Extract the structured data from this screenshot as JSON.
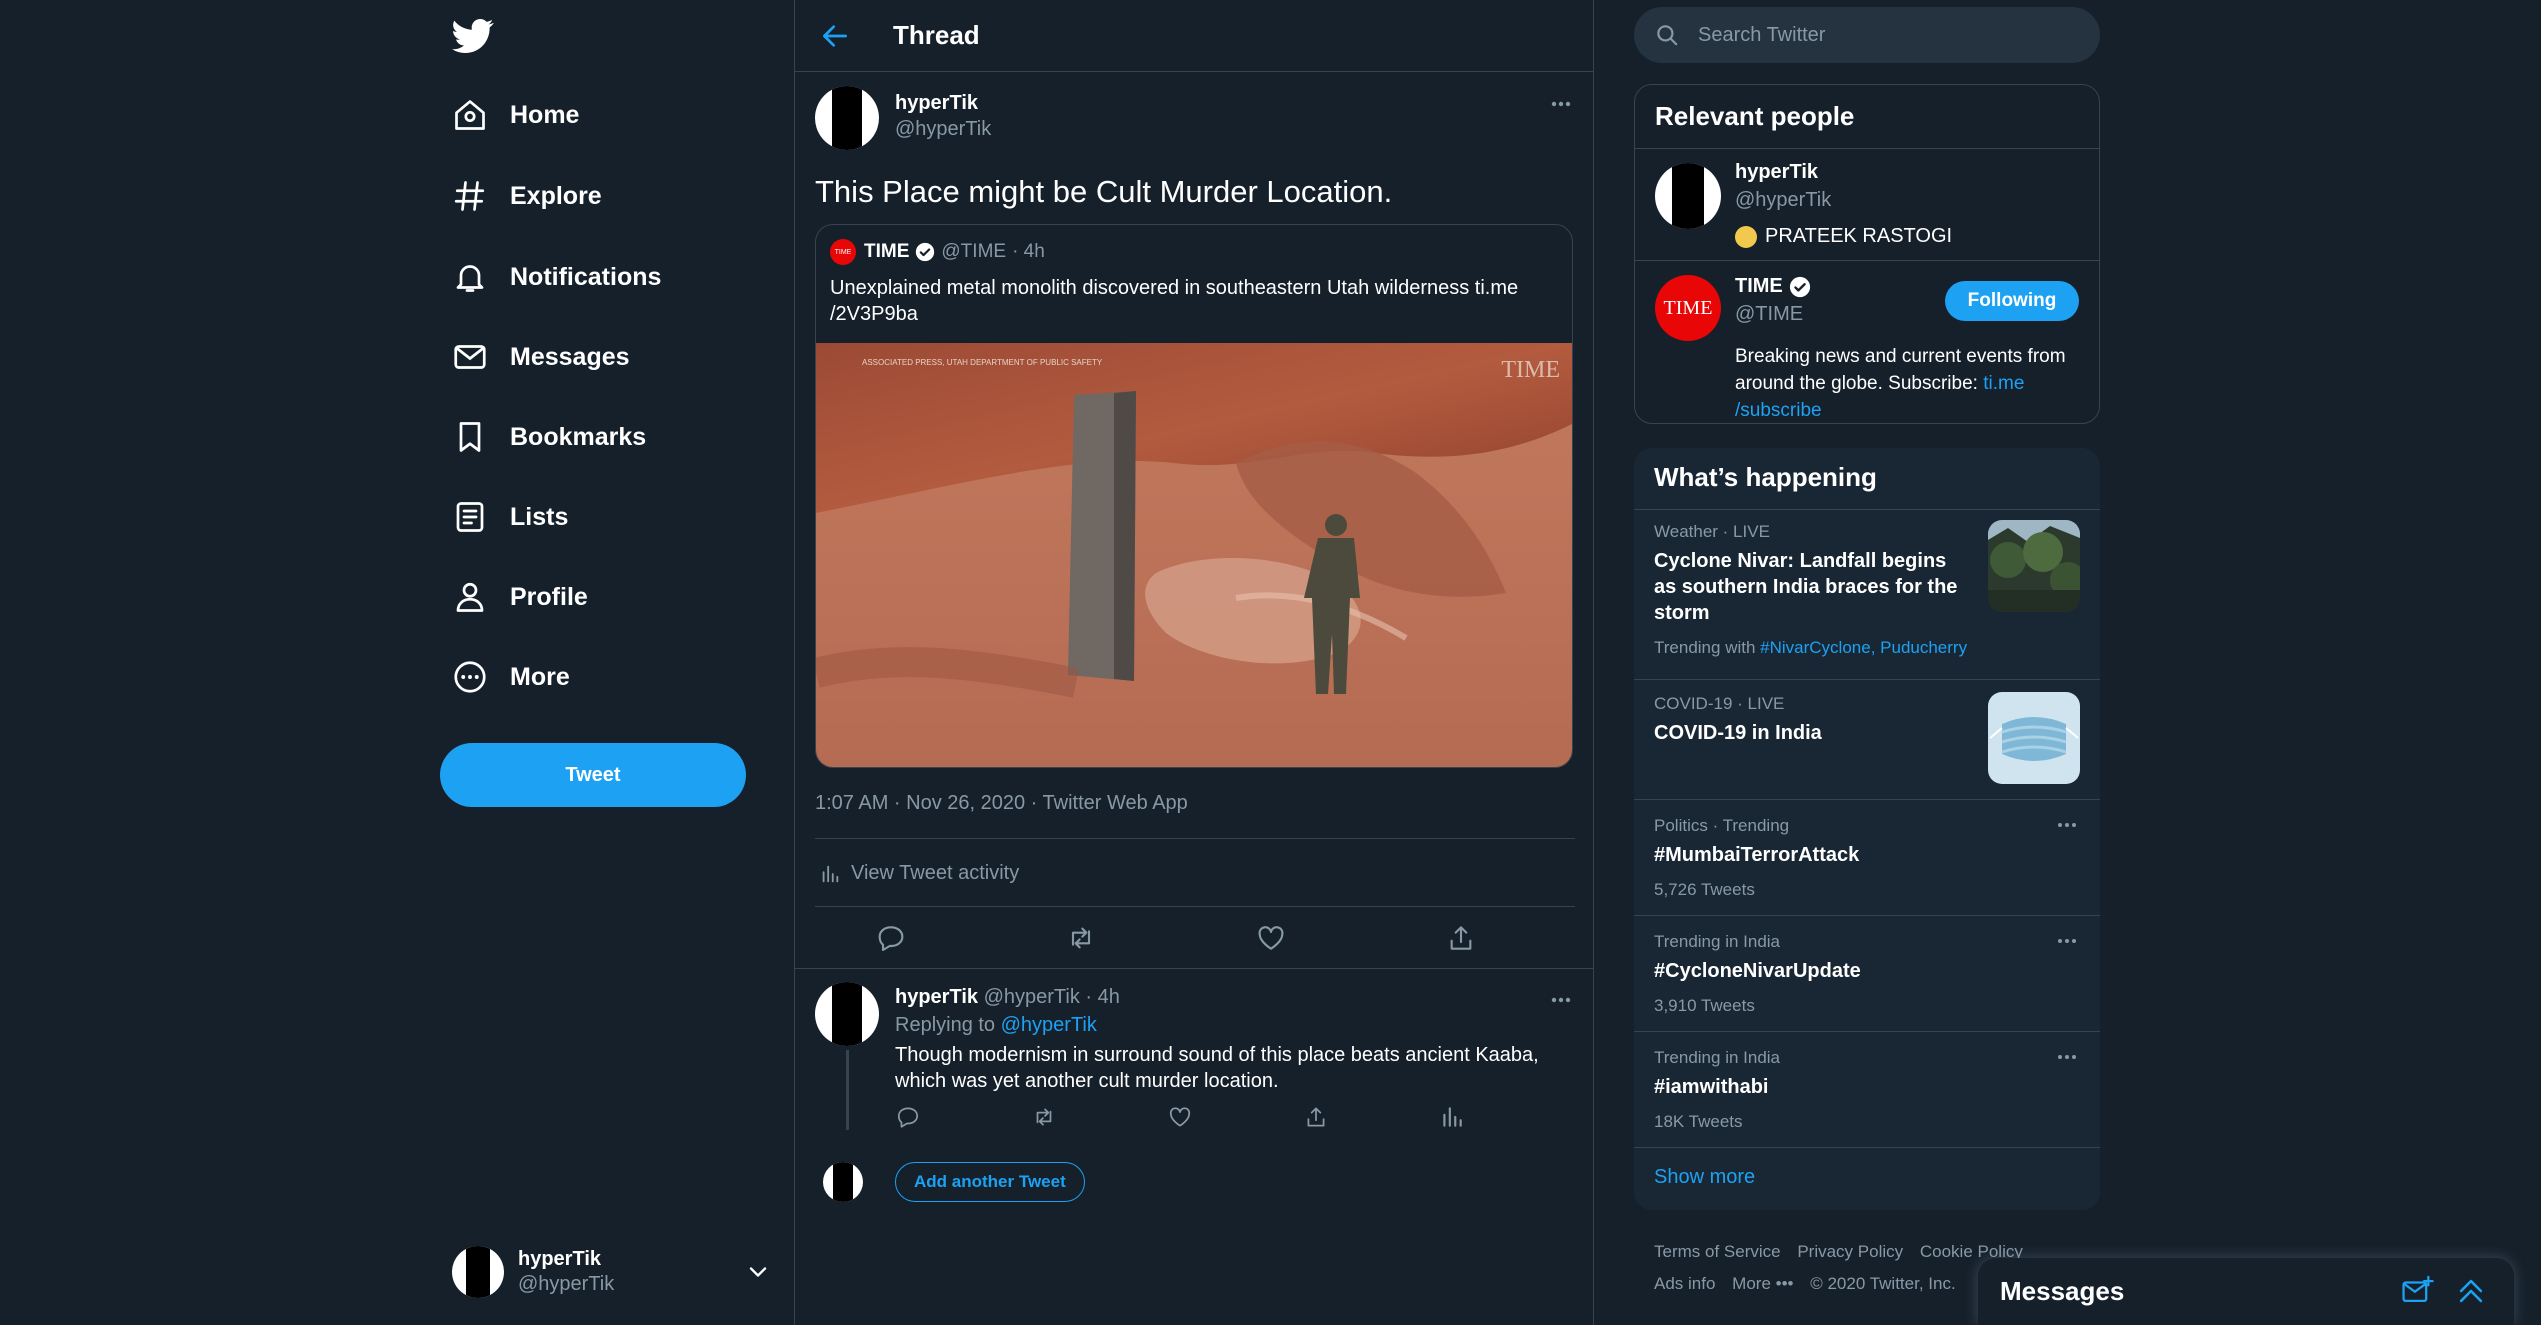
{
  "nav": {
    "items": [
      {
        "label": "Home",
        "icon": "home-icon"
      },
      {
        "label": "Explore",
        "icon": "hashtag-icon"
      },
      {
        "label": "Notifications",
        "icon": "bell-icon"
      },
      {
        "label": "Messages",
        "icon": "envelope-icon"
      },
      {
        "label": "Bookmarks",
        "icon": "bookmark-icon"
      },
      {
        "label": "Lists",
        "icon": "list-icon"
      },
      {
        "label": "Profile",
        "icon": "person-icon"
      },
      {
        "label": "More",
        "icon": "more-circle-icon"
      }
    ],
    "tweet_button": "Tweet",
    "account": {
      "name": "hyperTik",
      "handle": "@hyperTik"
    }
  },
  "header": {
    "title": "Thread"
  },
  "main_tweet": {
    "name": "hyperTik",
    "handle": "@hyperTik",
    "text": "This Place might be Cult Murder Location.",
    "quote": {
      "logo_text": "TIME",
      "name": "TIME",
      "handle": "@TIME",
      "time": "· 4h",
      "text": "Unexplained metal monolith discovered in southeastern Utah wilderness ti.me /2V3P9ba",
      "media_credit": "ASSOCIATED PRESS, UTAH DEPARTMENT OF PUBLIC SAFETY",
      "media_watermark": "TIME"
    },
    "meta": "1:07 AM · Nov 26, 2020 · Twitter Web App",
    "activity": "View Tweet activity"
  },
  "reply": {
    "name": "hyperTik",
    "handle": "@hyperTik",
    "time": "· 4h",
    "replying_prefix": "Replying to",
    "replying_to": "@hyperTik",
    "text": "Though modernism in surround sound of this place beats ancient Kaaba, which was yet another cult murder location."
  },
  "add_tweet_button": "Add another Tweet",
  "search": {
    "placeholder": "Search Twitter"
  },
  "relevant_people": {
    "title": "Relevant people",
    "people": [
      {
        "name": "hyperTik",
        "handle": "@hyperTik",
        "bio": "PRATEEK RASTOGI"
      },
      {
        "name": "TIME",
        "handle": "@TIME",
        "avatar_text": "TIME",
        "button": "Following",
        "bio": "Breaking news and current events from around the globe. Subscribe: ",
        "bio_link": "ti.me /subscribe"
      }
    ]
  },
  "whats_happening": {
    "title": "What’s happening",
    "trends": [
      {
        "meta": "Weather · LIVE",
        "title": "Cyclone Nivar: Landfall begins as southern India braces for the storm",
        "sub_prefix": "Trending with ",
        "sub_links": "#NivarCyclone, Puducherry"
      },
      {
        "meta": "COVID-19 · LIVE",
        "title": "COVID-19 in India"
      },
      {
        "meta": "Politics · Trending",
        "title": "#MumbaiTerrorAttack",
        "sub": "5,726 Tweets"
      },
      {
        "meta": "Trending in India",
        "title": "#CycloneNivarUpdate",
        "sub": "3,910 Tweets"
      },
      {
        "meta": "Trending in India",
        "title": "#iamwithabi",
        "sub": "18K Tweets"
      }
    ],
    "show_more": "Show more"
  },
  "footer": {
    "links": [
      "Terms of Service",
      "Privacy Policy",
      "Cookie Policy",
      "Ads info",
      "More •••"
    ],
    "copyright": "© 2020 Twitter, Inc."
  },
  "messages_drawer": {
    "title": "Messages"
  },
  "colors": {
    "accent": "#1da1f2",
    "background": "#15202b",
    "card": "#192734",
    "border": "#38444d",
    "muted": "#8899a6",
    "time_red": "#e90606"
  }
}
